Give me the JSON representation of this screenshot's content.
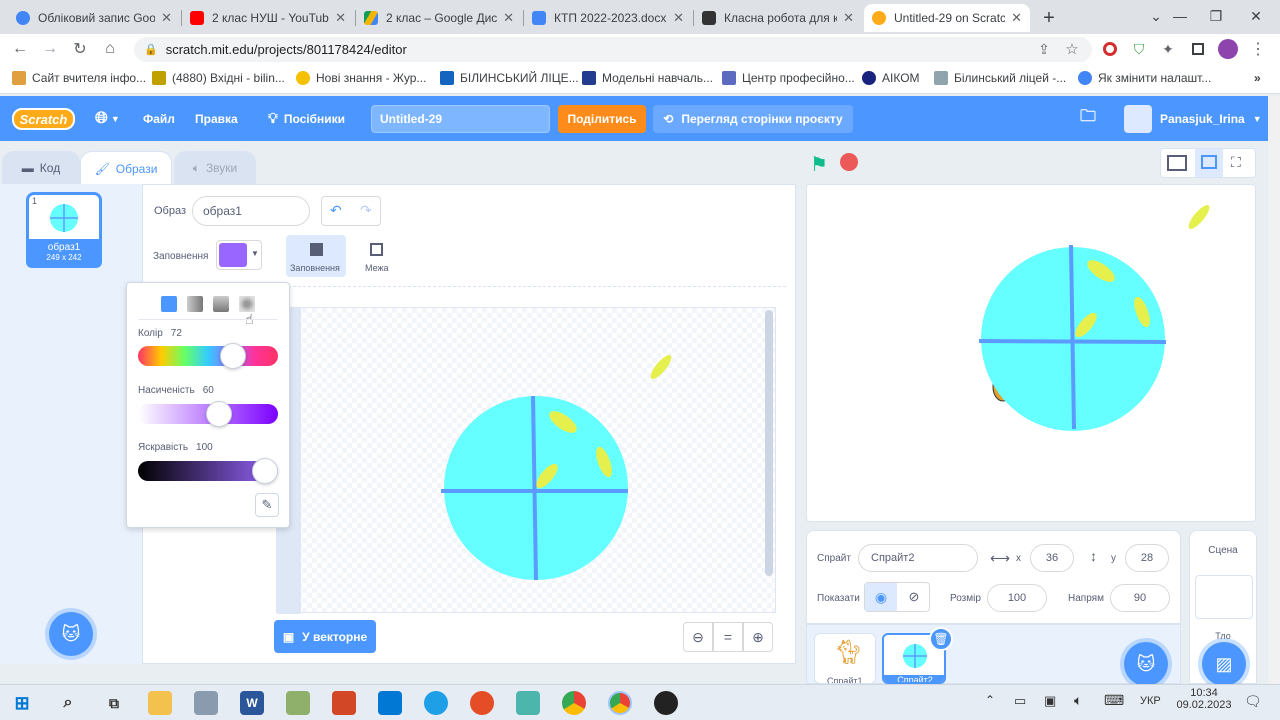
{
  "browser": {
    "tabs": [
      {
        "title": "Обліковий запис Goo",
        "icon": "google-icon",
        "color": "#4285f4"
      },
      {
        "title": "2 клас НУШ - YouTub",
        "icon": "youtube-icon",
        "color": "#ff0000"
      },
      {
        "title": "2 клас – Google Диск",
        "icon": "drive-icon",
        "color": "#0f9d58"
      },
      {
        "title": "КТП 2022-2023.docx",
        "icon": "docs-icon",
        "color": "#4285f4"
      },
      {
        "title": "Класна робота для ку",
        "icon": "classroom-icon",
        "color": "#333333"
      },
      {
        "title": "Untitled-29 on Scratch",
        "icon": "scratch-icon",
        "color": "#ffab19"
      }
    ],
    "url": "scratch.mit.edu/projects/801178424/editor",
    "bookmarks": [
      {
        "label": "Сайт вчителя інфо...",
        "color": "#e0a040"
      },
      {
        "label": "(4880) Вхідні - bilin...",
        "color": "#c0a000"
      },
      {
        "label": "Нові знання - Жур...",
        "color": "#f5c000"
      },
      {
        "label": "БІЛИНСЬКИЙ ЛІЦЕ...",
        "color": "#1565c0"
      },
      {
        "label": "Модельні навчаль...",
        "color": "#223d8f"
      },
      {
        "label": "Центр професійно...",
        "color": "#5c6bc0"
      },
      {
        "label": "АІКОМ",
        "color": "#1a237e"
      },
      {
        "label": "Білинський ліцей -...",
        "color": "#90a4ae"
      },
      {
        "label": "Як змінити налашт...",
        "color": "#4285f4"
      }
    ]
  },
  "menubar": {
    "logo": "Scratch",
    "file": "Файл",
    "edit": "Правка",
    "tutorials": "Посібники",
    "project_title": "Untitled-29",
    "share": "Поділитись",
    "project_page": "Перегляд сторінки проєкту",
    "username": "Panasjuk_Irina"
  },
  "editor_tabs": {
    "code": "Код",
    "costumes": "Образи",
    "sounds": "Звуки"
  },
  "costume": {
    "index": "1",
    "name": "образ1",
    "size": "249 x 242"
  },
  "paint": {
    "costume_label": "Образ",
    "costume_name": "образ1",
    "fill_label": "Заповнення",
    "fill_color": "#9966ff",
    "fill_tool": "Заповнення",
    "outline_tool": "Межа",
    "convert_button": "У векторне"
  },
  "color_picker": {
    "color_label": "Колір",
    "color_value": 72,
    "saturation_label": "Насиченість",
    "saturation_value": 60,
    "brightness_label": "Яскравість",
    "brightness_value": 100
  },
  "sprite_info": {
    "sprite_label": "Спрайт",
    "sprite_name": "Спрайт2",
    "x_label": "x",
    "x": "36",
    "y_label": "y",
    "y": "28",
    "show_label": "Показати",
    "size_label": "Розмір",
    "size": "100",
    "direction_label": "Напрям",
    "direction": "90"
  },
  "sprites": [
    {
      "name": "Спрайт1"
    },
    {
      "name": "Спрайт2"
    }
  ],
  "stage_panel": {
    "title": "Сцена",
    "backdrops": "Тло"
  },
  "taskbar": {
    "lang": "УКР",
    "time": "10:34",
    "date": "09.02.2023"
  },
  "colors": {
    "scratch_blue": "#4c97ff",
    "globe_cyan": "#66ffff",
    "leaf_yellow": "#e6f04d",
    "share_orange": "#ff8c1a"
  }
}
